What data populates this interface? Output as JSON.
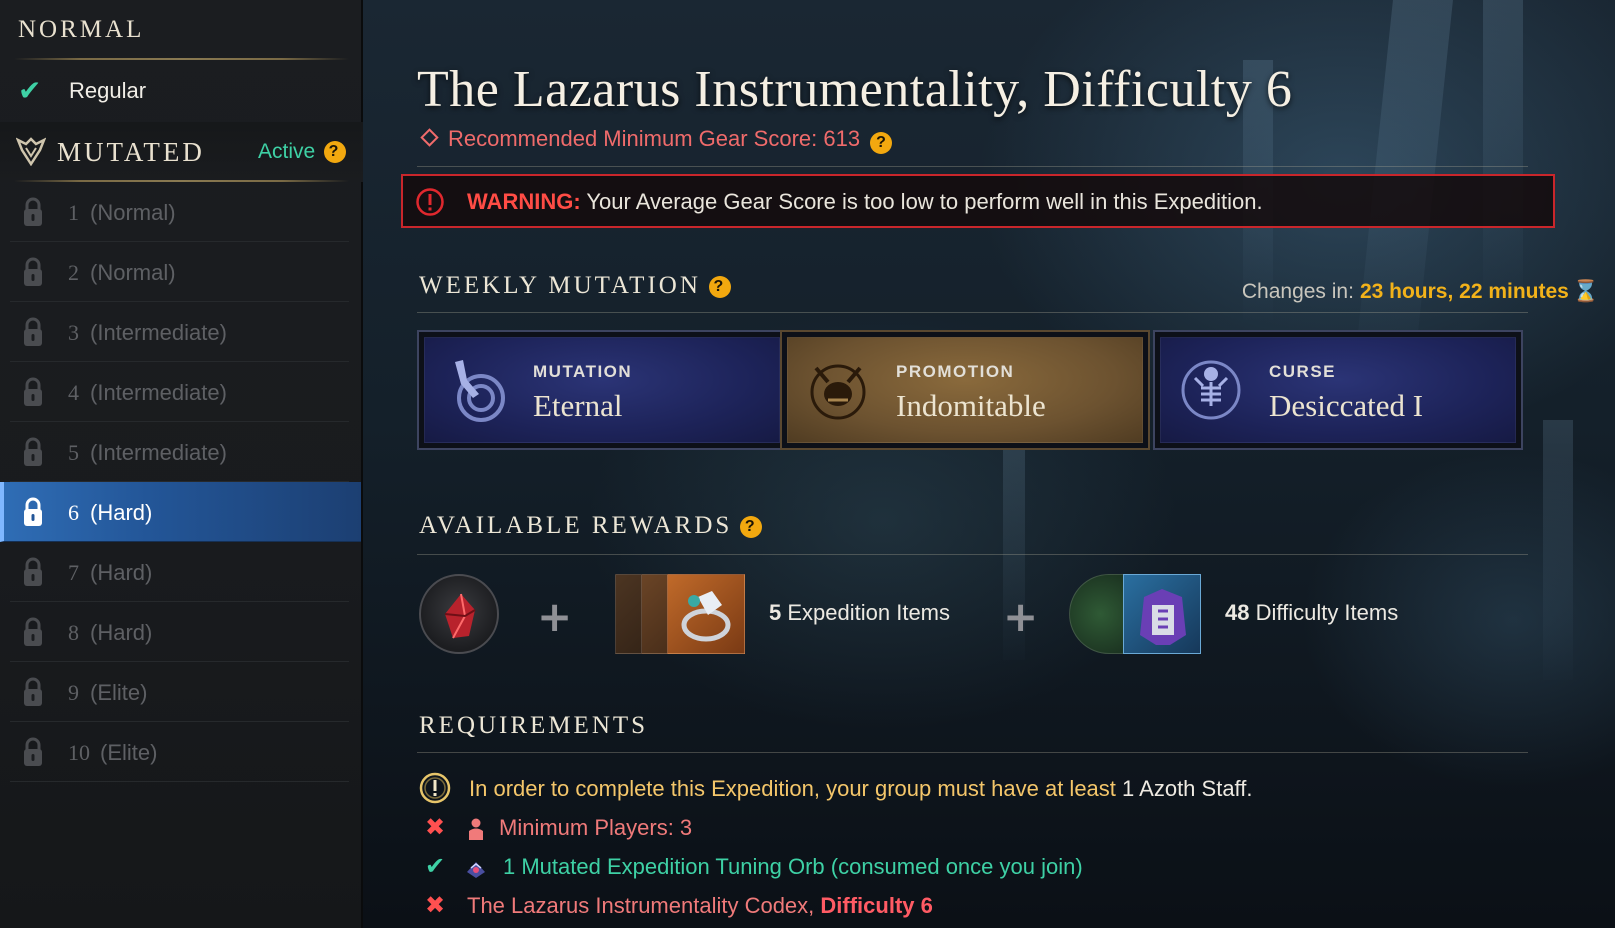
{
  "sidebar": {
    "normal_header": "NORMAL",
    "regular_label": "Regular",
    "mutated_header": "MUTATED",
    "mutated_status": "Active",
    "levels": [
      {
        "num": "1",
        "label": "(Normal)"
      },
      {
        "num": "2",
        "label": "(Normal)"
      },
      {
        "num": "3",
        "label": "(Intermediate)"
      },
      {
        "num": "4",
        "label": "(Intermediate)"
      },
      {
        "num": "5",
        "label": "(Intermediate)"
      },
      {
        "num": "6",
        "label": "(Hard)"
      },
      {
        "num": "7",
        "label": "(Hard)"
      },
      {
        "num": "8",
        "label": "(Hard)"
      },
      {
        "num": "9",
        "label": "(Elite)"
      },
      {
        "num": "10",
        "label": "(Elite)"
      }
    ],
    "selected_level": "6"
  },
  "main": {
    "title": "The Lazarus Instrumentality, Difficulty 6",
    "recommended": "Recommended Minimum Gear Score: 613",
    "warning_label": "WARNING:",
    "warning_text": " Your Average Gear Score is too low to perform well in this Expedition.",
    "weekly_mutation": {
      "title": "WEEKLY MUTATION",
      "changes_label": "Changes in:",
      "changes_time": "23 hours, 22 minutes",
      "cards": [
        {
          "kind": "MUTATION",
          "name": "Eternal",
          "icon": "wind-hand-icon"
        },
        {
          "kind": "PROMOTION",
          "name": "Indomitable",
          "icon": "horned-skull-icon"
        },
        {
          "kind": "CURSE",
          "name": "Desiccated I",
          "icon": "skeleton-icon"
        }
      ]
    },
    "rewards": {
      "title": "AVAILABLE REWARDS",
      "expedition_count": "5",
      "expedition_label": " Expedition Items",
      "difficulty_count": "48",
      "difficulty_label": " Difficulty Items"
    },
    "requirements": {
      "title": "REQUIREMENTS",
      "req1_text": "In order to complete this Expedition, your group must have at least ",
      "req1_item": "1 Azoth Staff.",
      "req2_text": "Minimum Players: 3",
      "req3_text": "1 Mutated Expedition Tuning Orb (consumed once you join)",
      "req4_text": "The Lazarus Instrumentality Codex, ",
      "req4_bold": "Difficulty 6"
    }
  },
  "colors": {
    "accent_green": "#3ed1a5",
    "warning_red": "#c9262b",
    "gold": "#f2b21a",
    "selected_blue": "#235698"
  }
}
